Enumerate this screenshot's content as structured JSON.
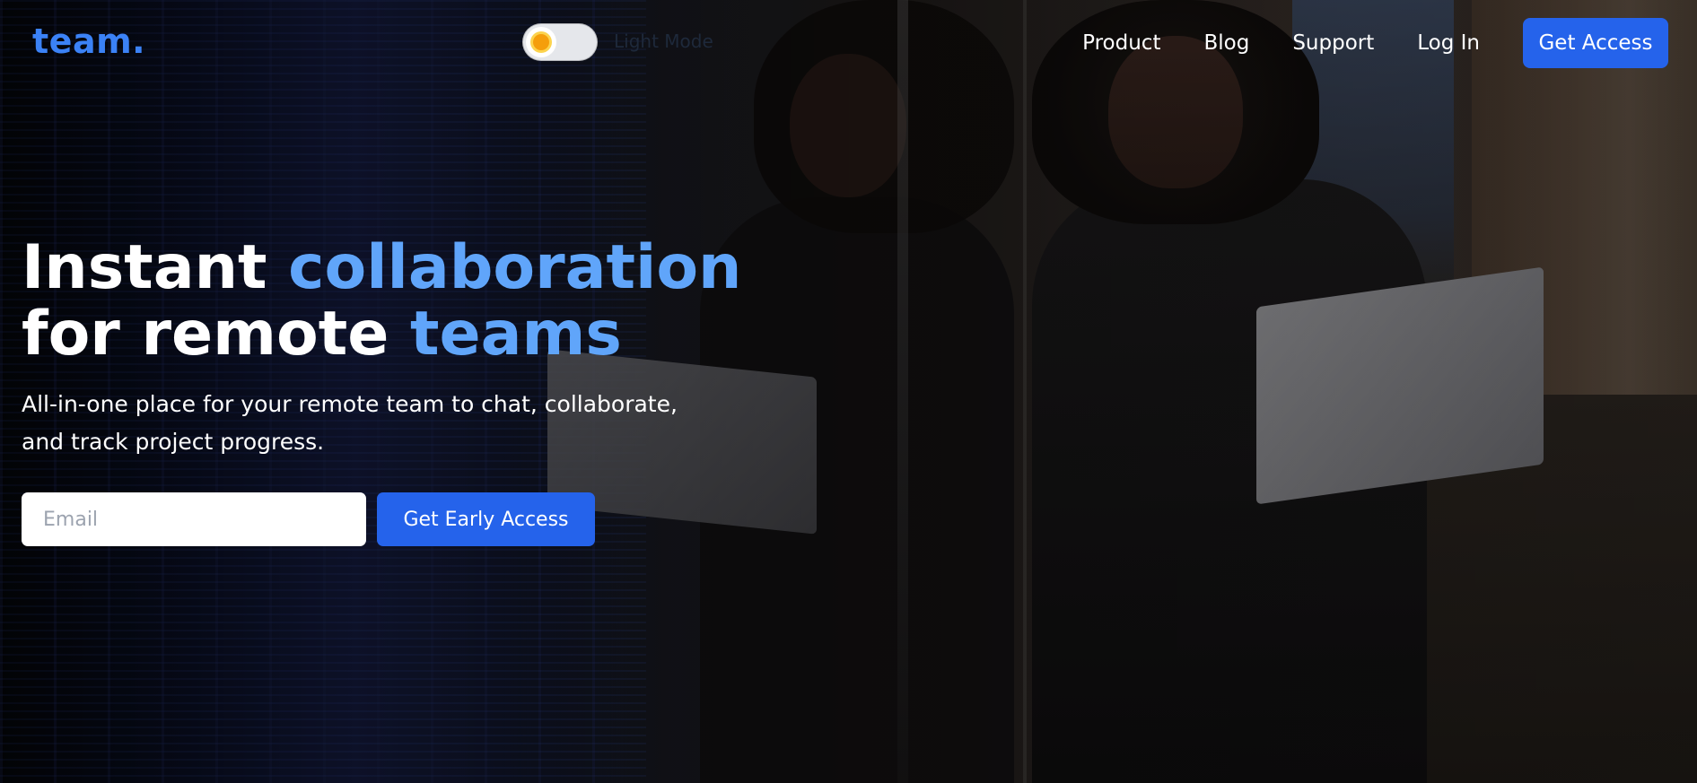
{
  "nav": {
    "logo": "team.",
    "theme_toggle": {
      "label": "Light Mode",
      "icon": "sun-icon"
    },
    "links": [
      "Product",
      "Blog",
      "Support",
      "Log In"
    ],
    "cta_label": "Get Access"
  },
  "hero": {
    "title_part1": "Instant ",
    "title_highlight1": "collaboration",
    "title_part2": "for remote ",
    "title_highlight2": "teams",
    "subtitle": "All-in-one place for your remote team to chat, collaborate, and track project progress.",
    "email_placeholder": "Email",
    "email_value": "",
    "cta_label": "Get Early Access"
  },
  "colors": {
    "brand": "#3b82f6",
    "highlight": "#60a5fa",
    "button": "#2563eb"
  }
}
